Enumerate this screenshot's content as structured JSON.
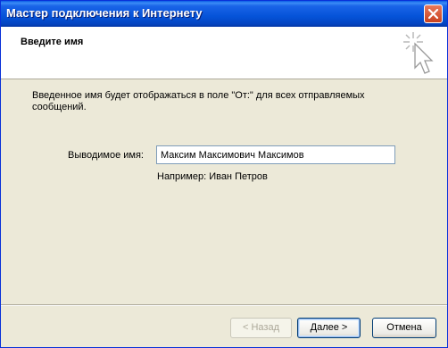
{
  "window": {
    "title": "Мастер подключения к Интернету"
  },
  "header": {
    "title": "Введите имя"
  },
  "content": {
    "description": "Введенное имя будет отображаться в поле \"От:\" для всех отправляемых сообщений.",
    "field_label": "Выводимое имя:",
    "field_value": "Максим Максимович Максимов",
    "example": "Например: Иван Петров"
  },
  "buttons": {
    "back": "< Назад",
    "next": "Далее >",
    "cancel": "Отмена"
  },
  "colors": {
    "titlebar": "#0553d8",
    "dialog_bg": "#ece9d8",
    "close_button": "#c9421f",
    "input_border": "#7f9db9"
  }
}
